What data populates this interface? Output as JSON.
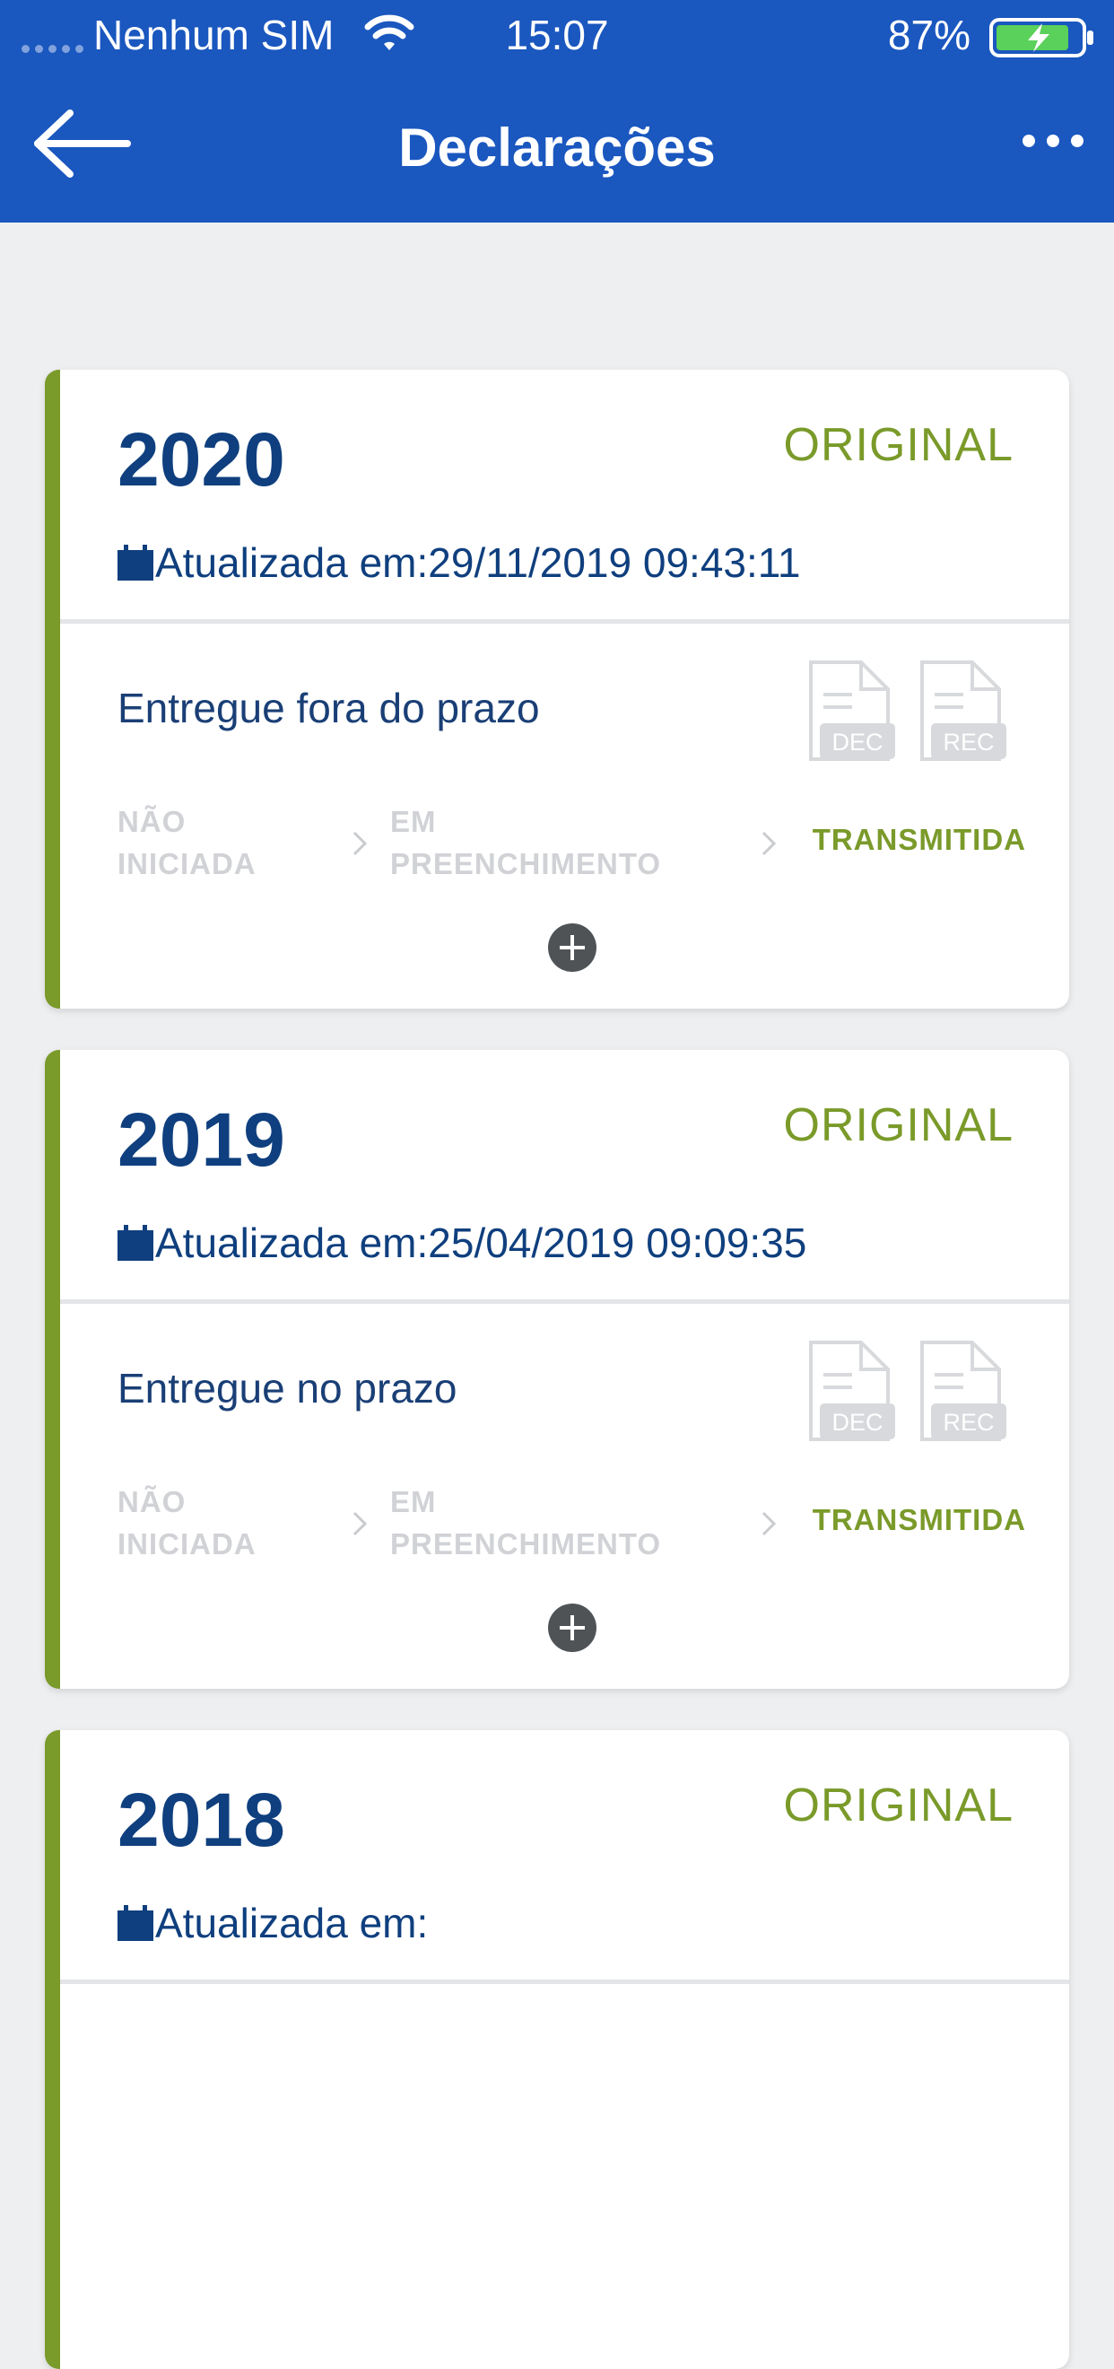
{
  "status_bar": {
    "carrier": "Nenhum SIM",
    "time": "15:07",
    "battery": "87%"
  },
  "nav": {
    "title": "Declarações"
  },
  "colors": {
    "header_blue": "#1a57bf",
    "accent_green": "#7a9a2a",
    "text_navy": "#0f3f7e"
  },
  "steps": {
    "step1": [
      "NÃO",
      "INICIADA"
    ],
    "step2": [
      "EM",
      "PREENCHIMENTO"
    ],
    "step3": "TRANSMITIDA",
    "active_step": 3
  },
  "doc_icons": {
    "dec_label": "DEC",
    "rec_label": "REC"
  },
  "declarations": [
    {
      "year": "2020",
      "type": "ORIGINAL",
      "updated": "Atualizada em:29/11/2019 09:43:11",
      "status": "Entregue fora do prazo"
    },
    {
      "year": "2019",
      "type": "ORIGINAL",
      "updated": "Atualizada em:25/04/2019 09:09:35",
      "status": "Entregue no prazo"
    },
    {
      "year": "2018",
      "type": "ORIGINAL",
      "updated": "Atualizada em:"
    }
  ]
}
